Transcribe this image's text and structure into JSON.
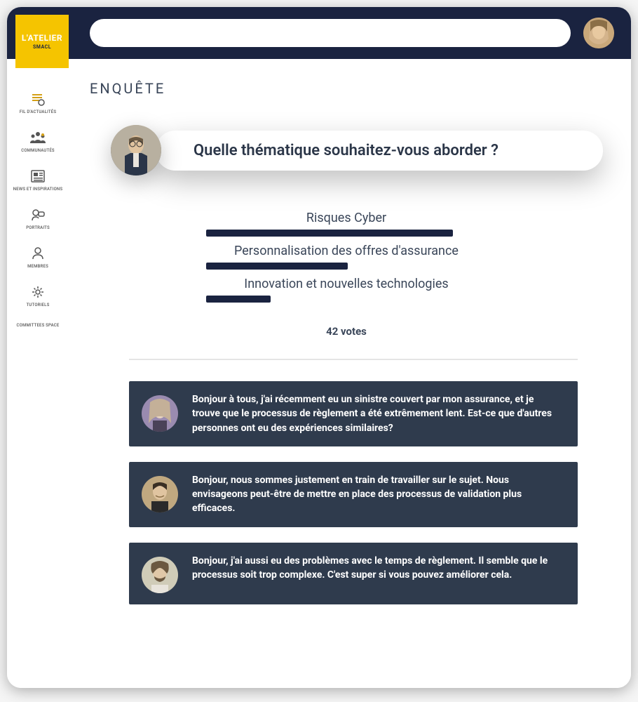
{
  "brand": {
    "name": "L'ATELIER",
    "sub": "SMACL"
  },
  "sidebar": {
    "items": [
      {
        "label": "FIL D'ACTUALITÉS"
      },
      {
        "label": "COMMUNAUTÉS"
      },
      {
        "label": "NEWS ET INSPIRATIONS"
      },
      {
        "label": "PORTRAITS"
      },
      {
        "label": "MEMBRES"
      },
      {
        "label": "TUTORIELS"
      },
      {
        "label": "COMMITTEES SPACE"
      }
    ]
  },
  "page": {
    "title": "ENQUÊTE",
    "survey": {
      "question": "Quelle thématique souhaitez-vous aborder ?",
      "options": [
        {
          "label": "Risques Cyber",
          "barWidthPx": 352
        },
        {
          "label": "Personnalisation des offres d'assurance",
          "barWidthPx": 202
        },
        {
          "label": "Innovation et nouvelles technologies",
          "barWidthPx": 92
        }
      ],
      "votesLabel": "42 votes"
    },
    "comments": [
      {
        "text": "Bonjour à tous, j'ai récemment eu un sinistre couvert par mon assurance, et je trouve que le processus de règlement a été extrêmement lent. Est-ce que d'autres personnes ont eu des expériences similaires?"
      },
      {
        "text": "Bonjour,  nous sommes justement en train de travailler sur le sujet. Nous envisageons peut-être de mettre en place des processus de validation plus efficaces."
      },
      {
        "text": "Bonjour,  j'ai aussi eu des problèmes avec le temps de règlement. Il semble que le processus soit trop complexe. C'est super si vous pouvez améliorer cela."
      }
    ]
  },
  "colors": {
    "commentAvatars": [
      "#c9b8d4",
      "#e0c4a0",
      "#d4d4c0"
    ]
  }
}
